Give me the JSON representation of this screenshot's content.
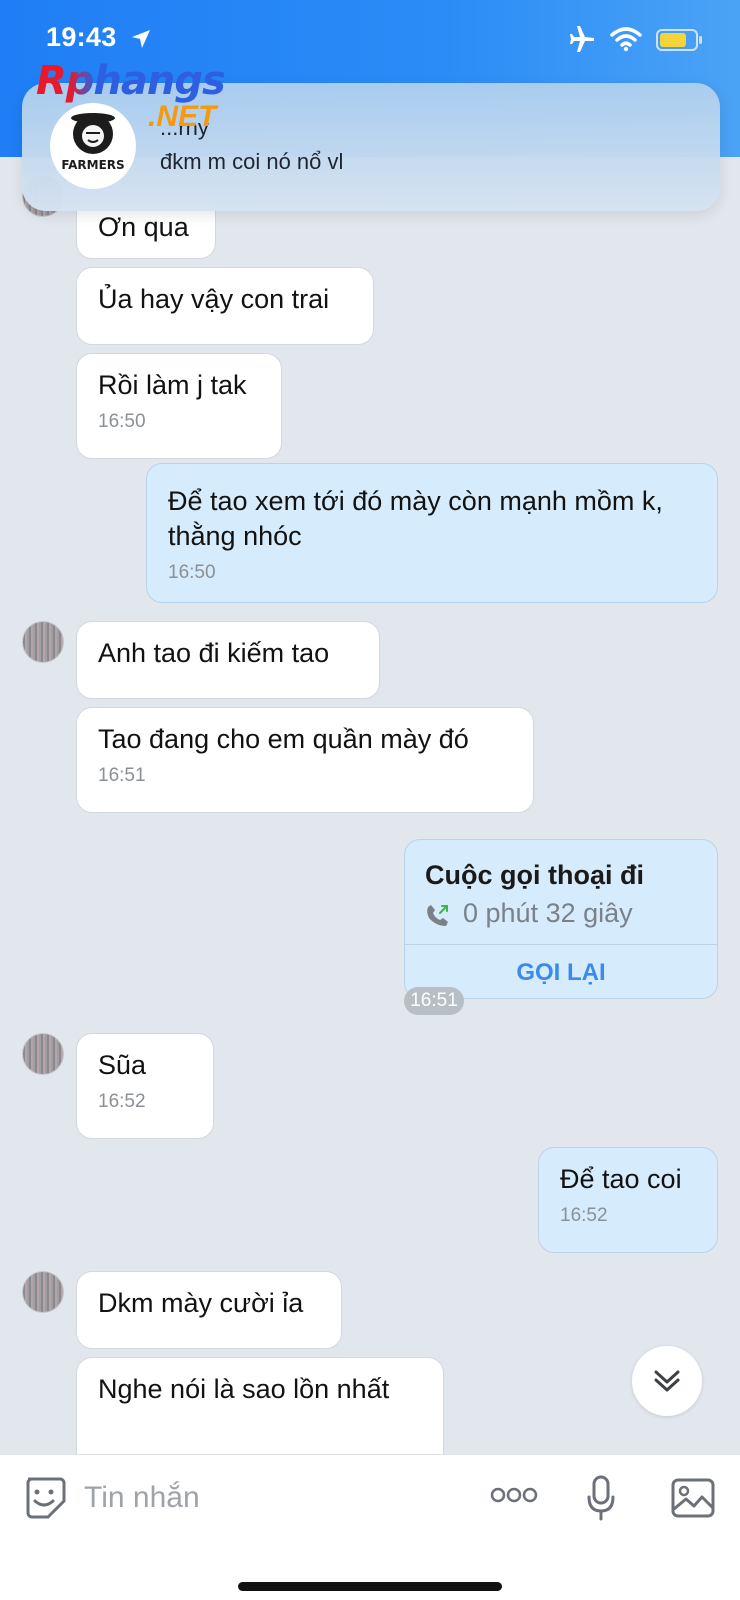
{
  "status_bar": {
    "time": "19:43"
  },
  "notification": {
    "sender": "...rny",
    "message": "đkm m coi nó nổ vl",
    "avatar_text": "FARMERS"
  },
  "watermark": {
    "main": "Rphangs",
    "suffix": ".NET"
  },
  "messages": [
    {
      "side": "in",
      "text": "Ơn qua",
      "time": ""
    },
    {
      "side": "in",
      "text": "Ủa hay vậy con trai",
      "time": ""
    },
    {
      "side": "in",
      "text": "Rồi làm j tak",
      "time": "16:50"
    },
    {
      "side": "out",
      "text": "Để tao xem tới đó mày còn mạnh mồm k, thằng nhóc",
      "time": "16:50"
    },
    {
      "side": "in",
      "text": "Anh tao đi kiếm tao",
      "time": ""
    },
    {
      "side": "in",
      "text": "Tao đang cho em quần mày đó",
      "time": "16:51"
    },
    {
      "side": "in",
      "text": "Sũa",
      "time": "16:52"
    },
    {
      "side": "out",
      "text": "Để tao coi",
      "time": "16:52"
    },
    {
      "side": "in",
      "text": "Dkm mày cười ỉa",
      "time": ""
    },
    {
      "side": "in",
      "text": "Nghe nói là sao lồn nhất",
      "time": ""
    }
  ],
  "call": {
    "title": "Cuộc gọi thoại đi",
    "duration": "0 phút 32 giây",
    "action": "GỌI LẠI",
    "time": "16:51"
  },
  "composer": {
    "placeholder": "Tin nhắn"
  },
  "colors": {
    "header": "#2b8cf7",
    "outgoing_bubble": "#d6ebfb",
    "incoming_bubble": "#ffffff",
    "accent": "#3a8bea"
  }
}
